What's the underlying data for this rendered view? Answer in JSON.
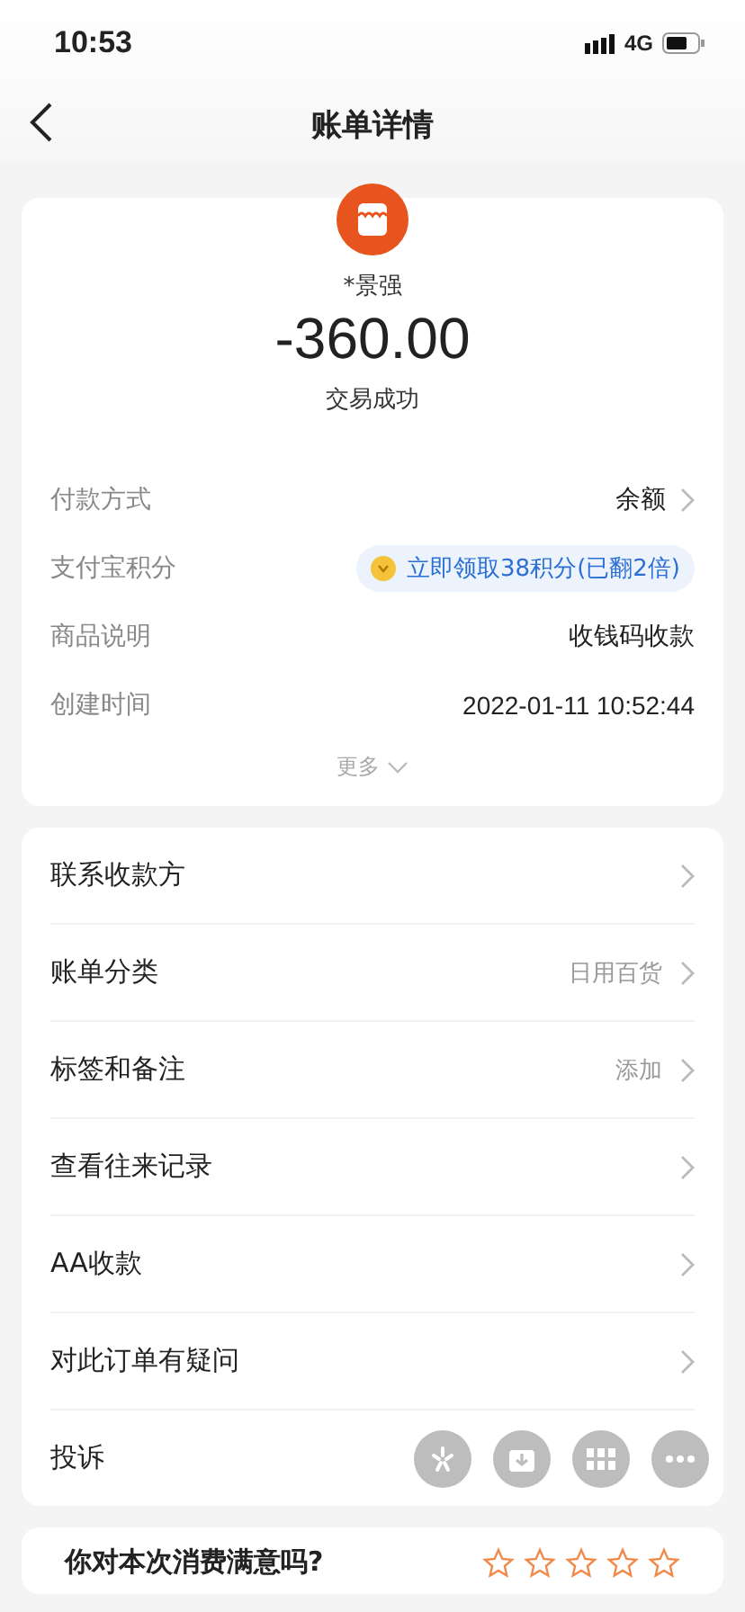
{
  "status_bar": {
    "time": "10:53",
    "network": "4G"
  },
  "nav": {
    "title": "账单详情"
  },
  "summary": {
    "payee": "*景强",
    "amount": "-360.00",
    "status": "交易成功"
  },
  "details": [
    {
      "kind": "link",
      "label": "付款方式",
      "value": "余额"
    },
    {
      "kind": "badge",
      "label": "支付宝积分",
      "value": "立即领取38积分(已翻2倍)"
    },
    {
      "kind": "plain",
      "label": "商品说明",
      "value": "收钱码收款"
    },
    {
      "kind": "plain",
      "label": "创建时间",
      "value": "2022-01-11 10:52:44"
    }
  ],
  "more": "更多",
  "actions": [
    {
      "label": "联系收款方",
      "chevron": true
    },
    {
      "label": "账单分类",
      "value": "日用百货",
      "chevron": true
    },
    {
      "label": "标签和备注",
      "value": "添加",
      "chevron": true
    },
    {
      "label": "查看往来记录",
      "chevron": true
    },
    {
      "label": "AA收款",
      "chevron": true
    },
    {
      "label": "对此订单有疑问",
      "chevron": true
    },
    {
      "label": "投诉",
      "chevron": false
    }
  ],
  "floating_buttons": [
    {
      "kind": "sparkle"
    },
    {
      "kind": "download"
    },
    {
      "kind": "grid"
    },
    {
      "kind": "more"
    }
  ],
  "rating": {
    "question": "你对本次消费满意吗?",
    "stars": 0
  }
}
